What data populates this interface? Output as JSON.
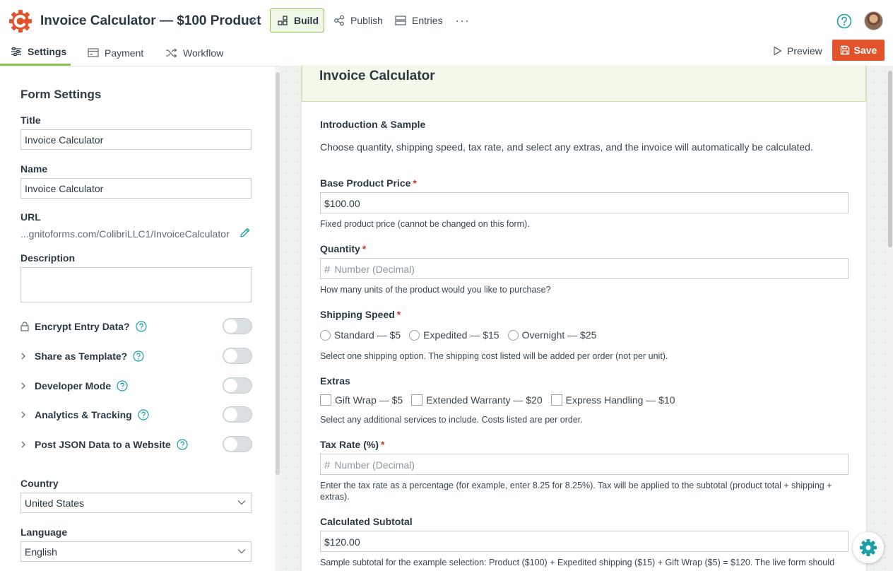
{
  "header": {
    "title": "Invoice Calculator — $100 Product",
    "nav": {
      "build": "Build",
      "publish": "Publish",
      "entries": "Entries",
      "more": "···"
    }
  },
  "subnav": {
    "settings": "Settings",
    "payment": "Payment",
    "workflow": "Workflow",
    "preview": "Preview",
    "save": "Save"
  },
  "settings_panel": {
    "heading": "Form Settings",
    "title_label": "Title",
    "title_value": "Invoice Calculator",
    "name_label": "Name",
    "name_value": "Invoice Calculator",
    "url_label": "URL",
    "url_value": "...gnitoforms.com/ColibriLLC1/InvoiceCalculator",
    "description_label": "Description",
    "description_value": "",
    "toggles": [
      {
        "label": "Encrypt Entry Data?",
        "on": false
      },
      {
        "label": "Share as Template?",
        "on": false
      },
      {
        "label": "Developer Mode",
        "on": false
      },
      {
        "label": "Analytics & Tracking",
        "on": false
      },
      {
        "label": "Post JSON Data to a Website",
        "on": false
      }
    ],
    "country_label": "Country",
    "country_value": "United States",
    "language_label": "Language",
    "language_value": "English"
  },
  "form": {
    "title": "Invoice Calculator",
    "intro_heading": "Introduction & Sample",
    "intro_text": "Choose quantity, shipping speed, tax rate, and select any extras, and the invoice will automatically be calculated.",
    "base_price": {
      "label": "Base Product Price",
      "required": "*",
      "value": "$100.00",
      "help": "Fixed product price (cannot be changed on this form)."
    },
    "quantity": {
      "label": "Quantity",
      "required": "*",
      "placeholder": "Number (Decimal)",
      "help": "How many units of the product would you like to purchase?"
    },
    "shipping": {
      "label": "Shipping Speed",
      "required": "*",
      "options": [
        "Standard — $5",
        "Expedited — $15",
        "Overnight — $25"
      ],
      "help": "Select one shipping option. The shipping cost listed will be added per order (not per unit)."
    },
    "extras": {
      "label": "Extras",
      "options": [
        "Gift Wrap — $5",
        "Extended Warranty — $20",
        "Express Handling — $10"
      ],
      "help": "Select any additional services to include. Costs listed are per order."
    },
    "tax_rate": {
      "label": "Tax Rate (%)",
      "required": "*",
      "placeholder": "Number (Decimal)",
      "help": "Enter the tax rate as a percentage (for example, enter 8.25 for 8.25%). Tax will be applied to the subtotal (product total + shipping + extras)."
    },
    "subtotal": {
      "label": "Calculated Subtotal",
      "value": "$120.00",
      "help": "Sample subtotal for the example selection: Product ($100) + Expedited shipping ($15) + Gift Wrap ($5) = $120. The live form should"
    }
  },
  "colors": {
    "accent_green": "#8cc152",
    "save_orange": "#e2522b",
    "teal": "#1a9fa5"
  }
}
